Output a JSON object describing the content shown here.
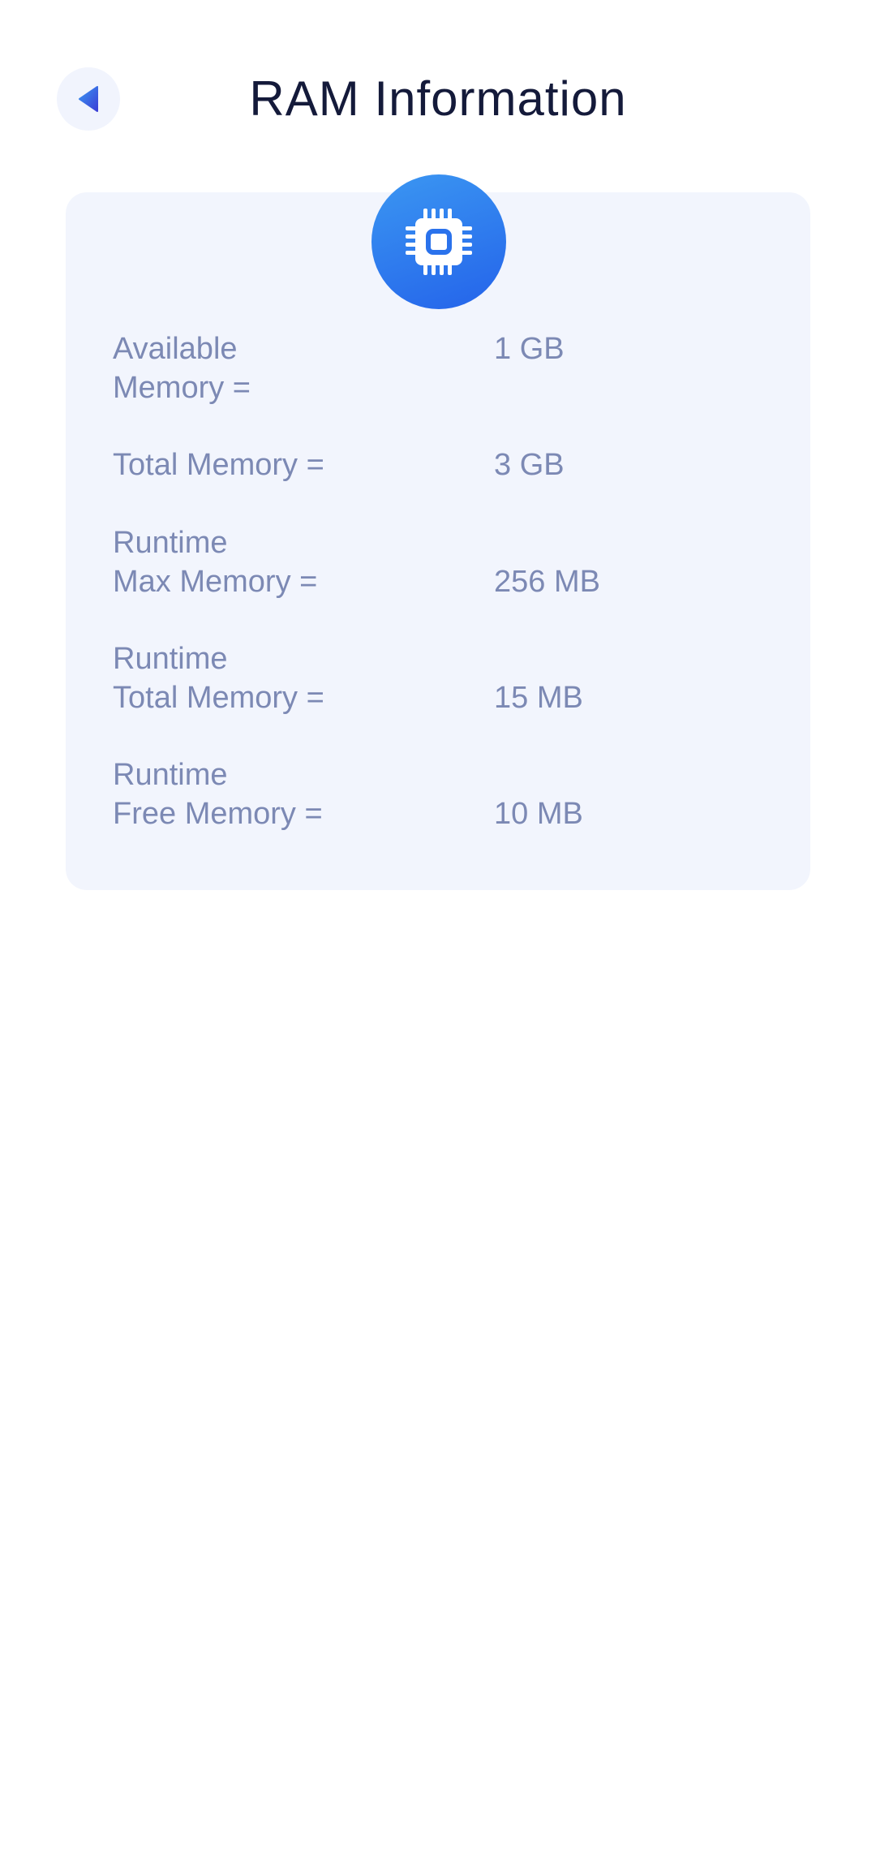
{
  "header": {
    "title": "RAM Information",
    "back_icon": "back-arrow-icon"
  },
  "card": {
    "icon": "memory-chip-icon",
    "accent_color": "#2463ea",
    "rows": [
      {
        "label_line1": "Available",
        "label_line2": "Memory =",
        "value": "1 GB"
      },
      {
        "label_line1": "Total Memory =",
        "label_line2": "",
        "value": "3 GB"
      },
      {
        "label_line1": "Runtime",
        "label_line2": "Max Memory =",
        "value": "256 MB"
      },
      {
        "label_line1": "Runtime",
        "label_line2": "Total Memory =",
        "value": "15 MB"
      },
      {
        "label_line1": "Runtime",
        "label_line2": "Free Memory =",
        "value": "10 MB"
      }
    ]
  }
}
